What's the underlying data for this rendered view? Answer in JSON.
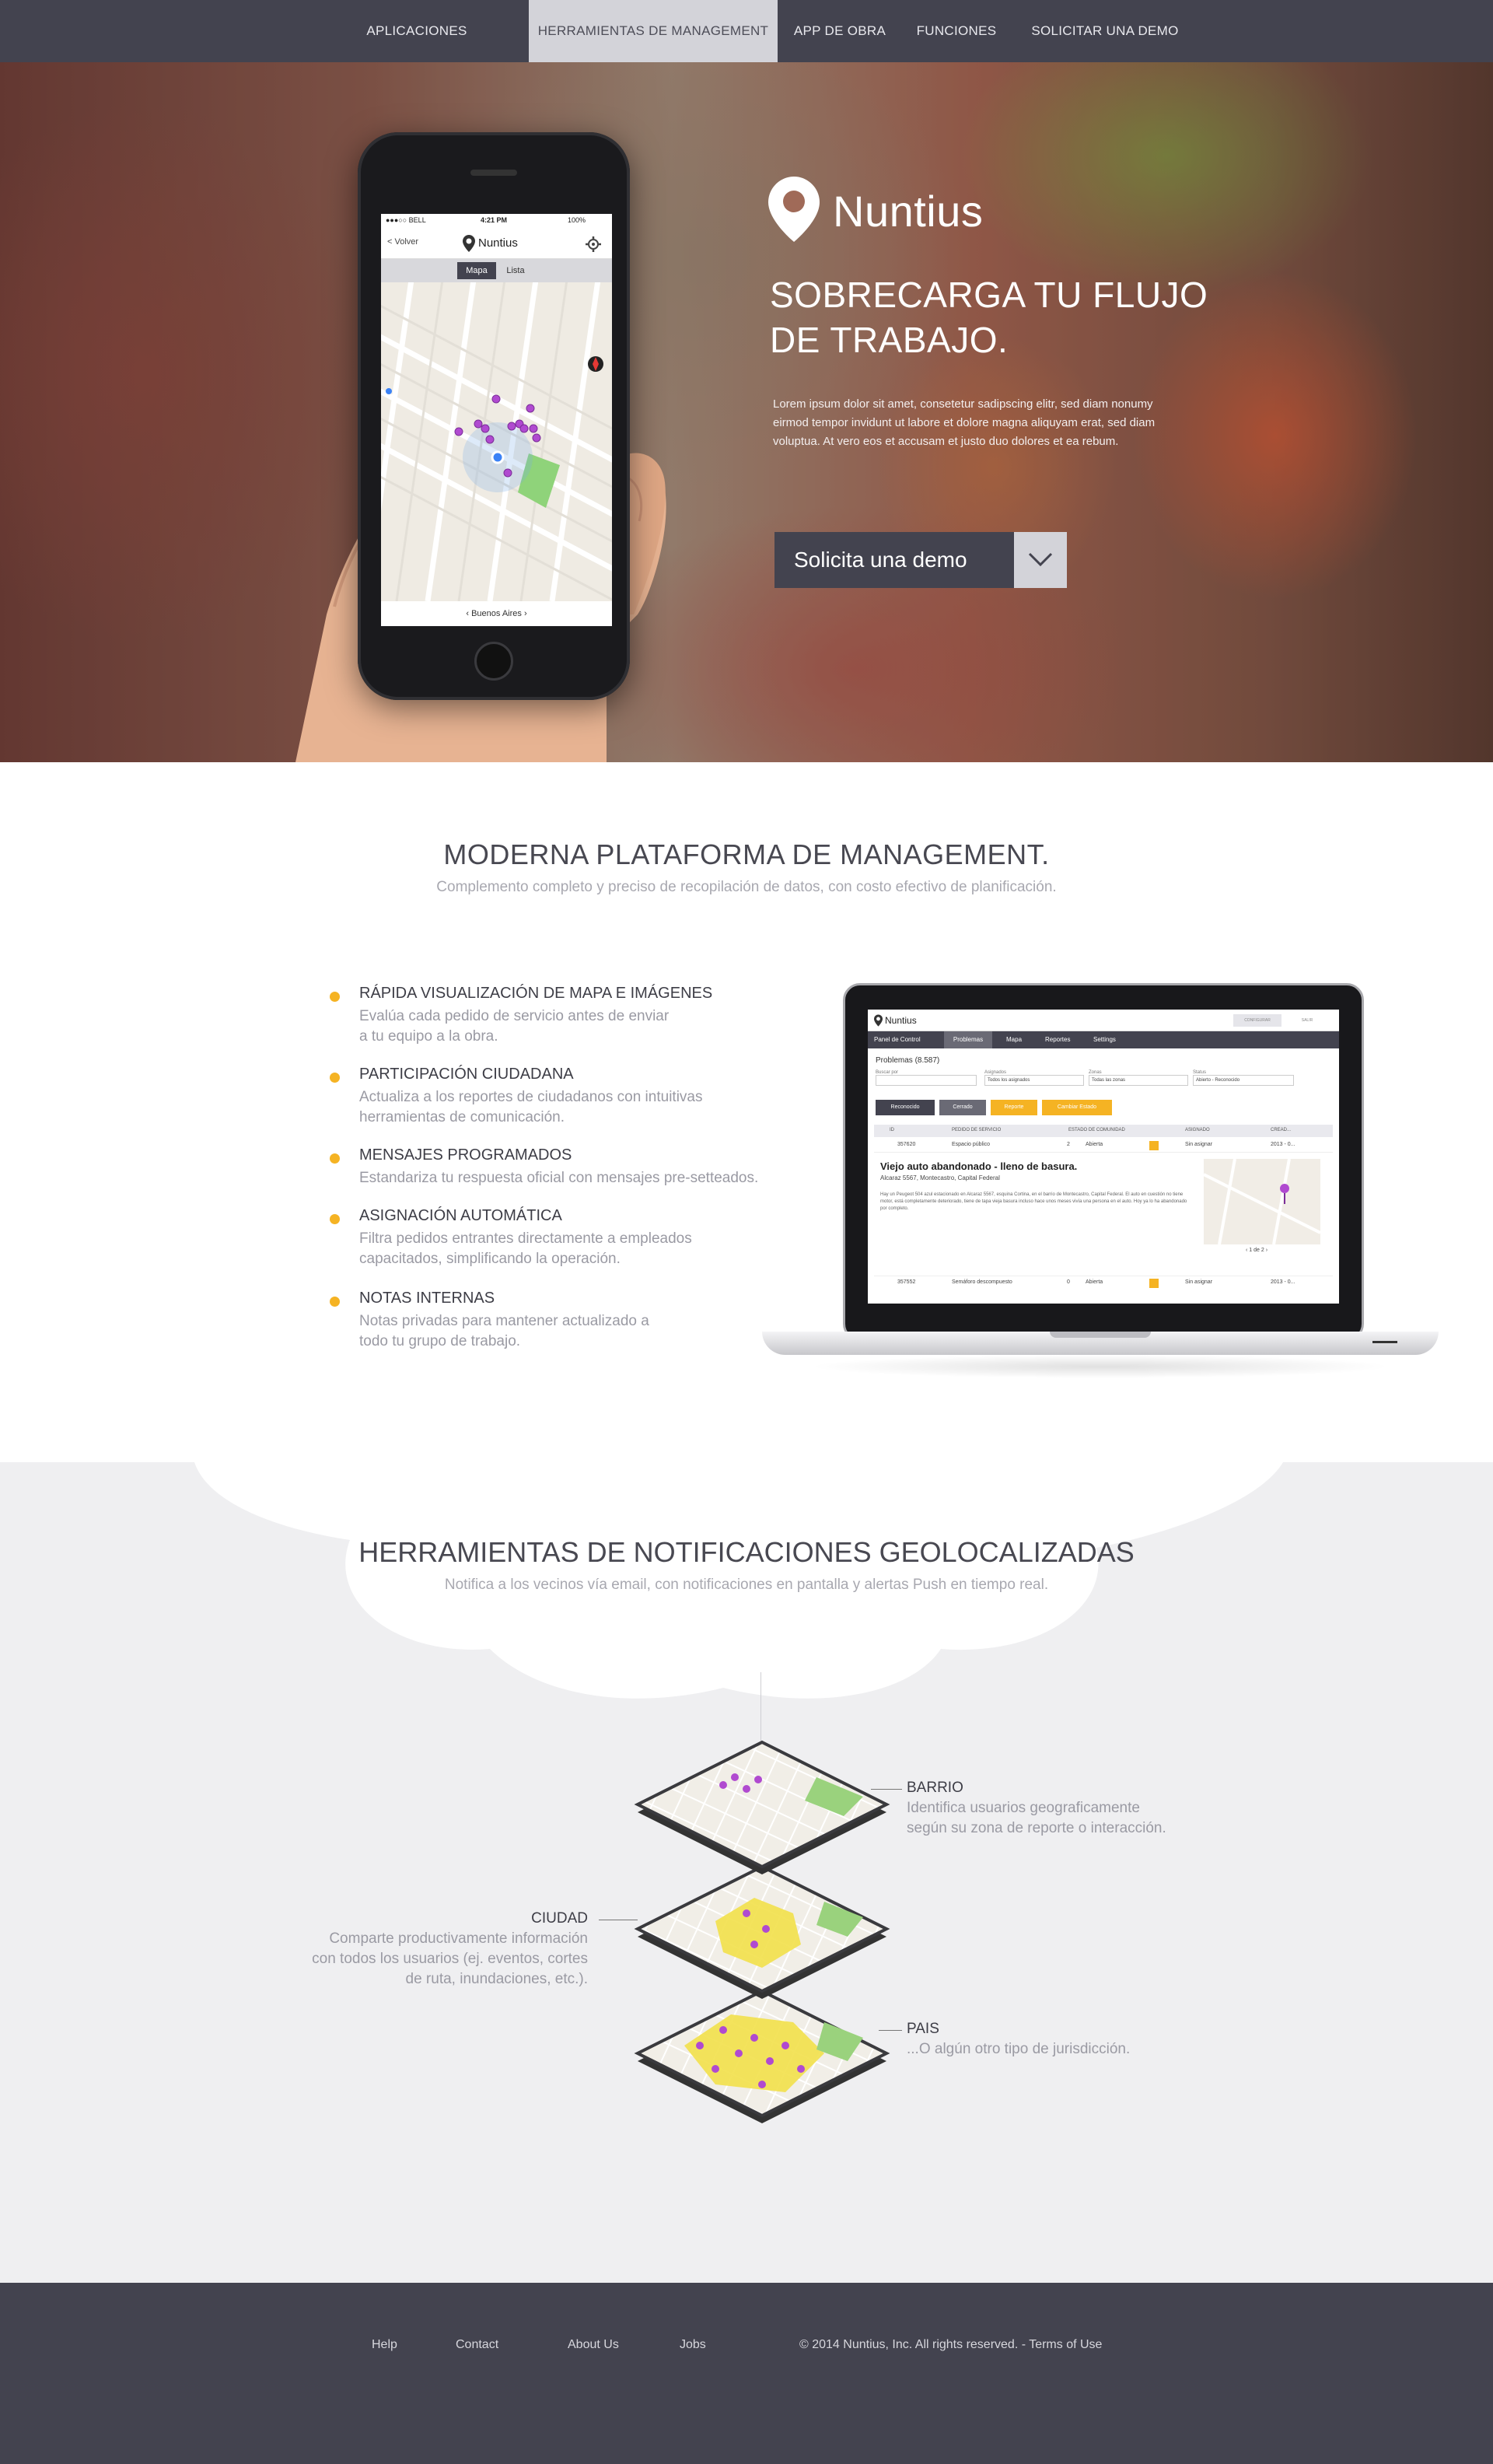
{
  "nav": {
    "items": [
      {
        "label": "APLICACIONES ESPECIALIZADAS"
      },
      {
        "label": "HERRAMIENTAS DE MANAGEMENT"
      },
      {
        "label": "APP DE OBRA"
      },
      {
        "label": "FUNCIONES"
      },
      {
        "label": "SOLICITAR UNA DEMO"
      }
    ]
  },
  "hero": {
    "brand": "Nuntius",
    "headline_line1": "SOBRECARGA TU FLUJO",
    "headline_line2": "DE TRABAJO.",
    "body": "Lorem ipsum dolor sit amet, consetetur sadipscing elitr, sed diam nonumy eirmod tempor invidunt ut labore et dolore magna aliquyam erat, sed diam voluptua. At vero eos et accusam et justo duo dolores et ea rebum.",
    "cta_label": "Solicita una demo",
    "phone": {
      "carrier": "●●●○○ BELL",
      "time": "4:21 PM",
      "battery": "100%",
      "back_label": "< Volver",
      "app_title": "Nuntius",
      "tab_map": "Mapa",
      "tab_list": "Lista",
      "footer_location": "Buenos Aires"
    }
  },
  "platform": {
    "title": "MODERNA PLATAFORMA DE MANAGEMENT.",
    "subtitle": "Complemento completo y preciso de recopilación de datos, con costo efectivo de planificación.",
    "features": [
      {
        "title": "RÁPIDA VISUALIZACIÓN DE MAPA E IMÁGENES",
        "desc_line1": "Evalúa cada pedido de servicio antes de enviar",
        "desc_line2": "a tu equipo a la obra."
      },
      {
        "title": "PARTICIPACIÓN CIUDADANA",
        "desc_line1": "Actualiza a los reportes de ciudadanos con intuitivas",
        "desc_line2": "herramientas de comunicación."
      },
      {
        "title": "MENSAJES PROGRAMADOS",
        "desc_line1": "Estandariza tu respuesta oficial con mensajes pre-setteados.",
        "desc_line2": ""
      },
      {
        "title": "ASIGNACIÓN AUTOMÁTICA",
        "desc_line1": "Filtra pedidos entrantes directamente a empleados",
        "desc_line2": "capacitados, simplificando la operación."
      },
      {
        "title": "NOTAS INTERNAS",
        "desc_line1": "Notas privadas para mantener actualizado a",
        "desc_line2": "todo tu grupo de trabajo."
      }
    ],
    "dashboard": {
      "brand": "Nuntius",
      "header_right1": "CONFIGURAR",
      "header_right2": "SALIR",
      "tabs": [
        "Panel de Control",
        "Problemas",
        "Mapa",
        "Reportes",
        "Settings"
      ],
      "section_title": "Problemas (8.587)",
      "filters": [
        {
          "label": "Buscar por",
          "value": ""
        },
        {
          "label": "Asignados",
          "value": "Todos los asignados"
        },
        {
          "label": "Zonas",
          "value": "Todas las zonas"
        },
        {
          "label": "Status",
          "value": "Abierto - Reconocido"
        }
      ],
      "buttons": [
        "Reconocido",
        "Cerrado",
        "Reporte",
        "Cambiar Estado"
      ],
      "columns": [
        "ID",
        "PEDIDO DE SERVICIO",
        "ESTADO DE COMUNIDAD",
        "ASIGNADO",
        "CREAD..."
      ],
      "rows": [
        {
          "id": "357620",
          "service": "Espacio público",
          "count": "2",
          "status": "Abierta",
          "assigned": "Sin asignar",
          "created": "2013 - 0..."
        },
        {
          "id": "357552",
          "service": "Semáforo descompuesto",
          "count": "0",
          "status": "Abierta",
          "assigned": "Sin asignar",
          "created": "2013 - 0..."
        }
      ],
      "detail": {
        "title": "Viejo auto abandonado - lleno de basura.",
        "address": "Alcaraz 5567, Montecastro, Capital Federal",
        "body": "Hay un Peugeot 504 azul estacionado en Alcaraz 5567, esquina Cortina, en el barrio de Montecastro, Capital Federal. El auto en cuestión no tiene motor, está completamente deteriorado, tiene de tapa vieja basura incluso hace unos meses vivía una persona en el auto. Hoy ya lo ha abandonado por completo.",
        "pager": "1 de 2"
      }
    }
  },
  "geo": {
    "title": "HERRAMIENTAS DE NOTIFICACIONES GEOLOCALIZADAS",
    "subtitle": "Notifica a los vecinos vía email, con notificaciones en pantalla y alertas Push en tiempo real.",
    "barrio": {
      "label": "BARRIO",
      "desc_line1": "Identifica usuarios geograficamente",
      "desc_line2": "según su zona de reporte o interacción."
    },
    "ciudad": {
      "label": "CIUDAD",
      "desc_line1": "Comparte productivamente información",
      "desc_line2": "con todos los usuarios (ej. eventos, cortes",
      "desc_line3": "de ruta, inundaciones, etc.)."
    },
    "pais": {
      "label": "PAIS",
      "desc_line1": "...O algún otro tipo de jurisdicción."
    }
  },
  "footer": {
    "links": [
      "Help",
      "Contact",
      "About Us",
      "Jobs"
    ],
    "copyright": "© 2014 Nuntius, Inc. All rights reserved. - Terms of Use"
  },
  "colors": {
    "nav_bg": "#43434f",
    "accent": "#f5b323",
    "pin": "#b04ad0",
    "map_yellow": "#f2e04a"
  }
}
